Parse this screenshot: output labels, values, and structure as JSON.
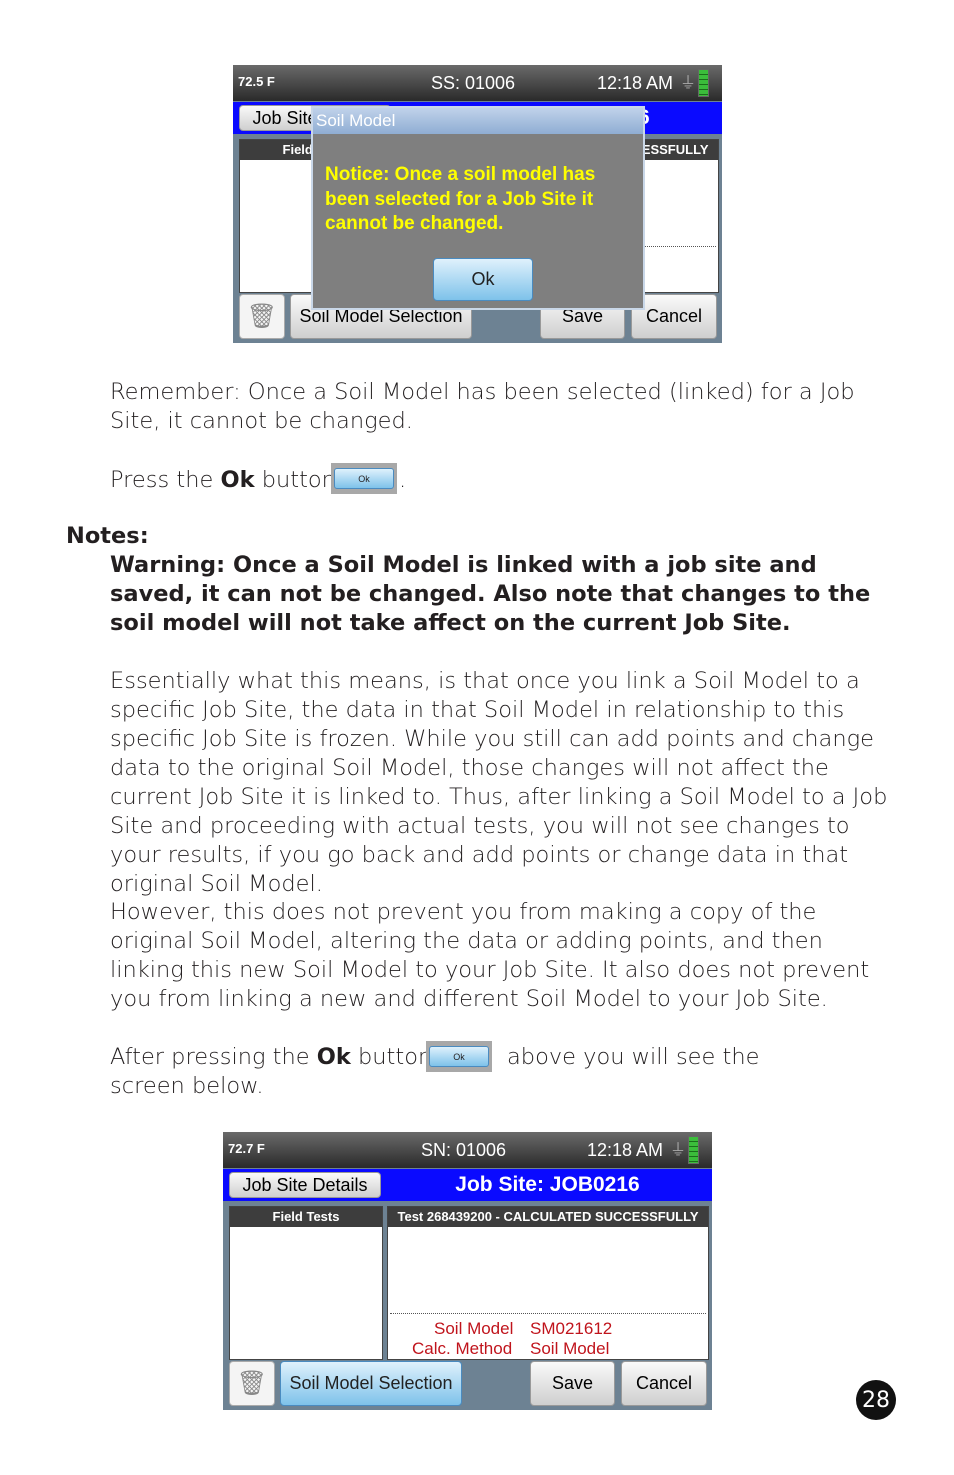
{
  "screen1": {
    "temp": "72.5 F",
    "serial": "SS: 01006",
    "time": "12:18 AM",
    "job_site_button": "Job Site Details",
    "title": "Job Site: JOB0216",
    "field_tests_header": "Field Tests",
    "test_header": "Test 268439200 - CALCULATED SUCCESSFULLY",
    "soil_model_button": "Soil Model Selection",
    "save_button": "Save",
    "cancel_button": "Cancel",
    "dialog": {
      "title": "Soil Model",
      "message": "Notice:  Once a soil model has been selected for a Job Site it cannot be changed.",
      "ok_button": "Ok"
    }
  },
  "text": {
    "remember": "Remember: Once a Soil Model has been selected (linked) for a Job Site, it cannot be changed.",
    "press_pre": "Press the ",
    "press_bold": "Ok",
    "press_post": " button",
    "press_end": ".",
    "inline_ok": "Ok",
    "notes_heading": "Notes:",
    "warning": "Warning: Once a Soil Model is linked with a job site and saved, it can not be changed. Also note that changes to the soil model will not take affect on the current Job Site.",
    "para1": "Essentially what this means, is that once you link a Soil Model to a specific Job Site, the data in that Soil Model in relationship to this specific Job Site is frozen. While you still can add points and change data to the original Soil Model, those changes will not affect the current Job Site it is linked to. Thus, after linking a Soil Model to a Job Site and proceeding with actual tests, you will not see changes to your results, if you go back and add points or change data in that original Soil Model.",
    "para2": "However, this does not prevent you from making a copy of the original Soil Model, altering the data or adding points, and then linking this new Soil Model to your Job Site. It also does not prevent you from linking a new and different Soil Model to your Job Site.",
    "after_pre": "After pressing the ",
    "after_bold": "Ok",
    "after_mid": " button",
    "after_post": "above you will see the screen below."
  },
  "screen2": {
    "temp": "72.7 F",
    "serial": "SN: 01006",
    "time": "12:18 AM",
    "job_site_button": "Job Site Details",
    "title": "Job Site:  JOB0216",
    "field_tests_header": "Field Tests",
    "test_header": "Test 268439200 - CALCULATED SUCCESSFULLY",
    "soil_model_label": "Soil Model",
    "soil_model_value": "SM021612",
    "calc_method_label": "Calc. Method",
    "calc_method_value": "Soil Model",
    "soil_model_button": "Soil Model Selection",
    "save_button": "Save",
    "cancel_button": "Cancel"
  },
  "page_number": "28",
  "colors": {
    "status_blue": "#0a0aff",
    "notice_yellow": "#ffff00",
    "result_red": "#c0141c"
  }
}
